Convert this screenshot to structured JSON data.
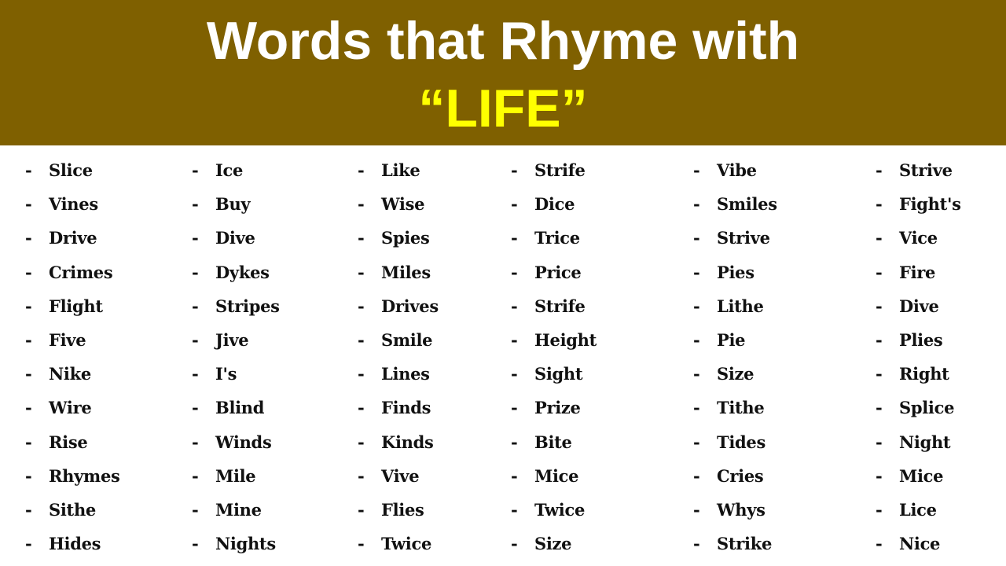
{
  "header": {
    "title_line1": "Words that Rhyme with",
    "title_line2": "“LIFE”",
    "background_color": "#7f6000",
    "title_color": "#ffffff",
    "highlight_color": "#ffff00"
  },
  "bullet": "-",
  "columns": [
    [
      "Slice",
      "Vines",
      "Drive",
      "Crimes",
      "Flight",
      "Five",
      "Nike",
      "Wire",
      "Rise",
      "Rhymes",
      "Sithe",
      "Hides"
    ],
    [
      "Ice",
      "Buy",
      "Dive",
      "Dykes",
      "Stripes",
      "Jive",
      "I's",
      "Blind",
      "Winds",
      "Mile",
      "Mine",
      "Nights"
    ],
    [
      "Like",
      "Wise",
      "Spies",
      "Miles",
      "Drives",
      "Smile",
      "Lines",
      "Finds",
      "Kinds",
      "Vive",
      "Flies",
      "Twice"
    ],
    [
      "Strife",
      "Dice",
      "Trice",
      "Price",
      "Strife",
      "Height",
      "Sight",
      "Prize",
      "Bite",
      "Mice",
      "Twice",
      "Size"
    ],
    [
      "Vibe",
      "Smiles",
      "Strive",
      "Pies",
      "Lithe",
      "Pie",
      "Size",
      "Tithe",
      "Tides",
      "Cries",
      "Whys",
      "Strike"
    ],
    [
      "Strive",
      "Fight's",
      "Vice",
      "Fire",
      "Dive",
      "Plies",
      "Right",
      "Splice",
      "Night",
      "Mice",
      "Lice",
      "Nice"
    ]
  ]
}
